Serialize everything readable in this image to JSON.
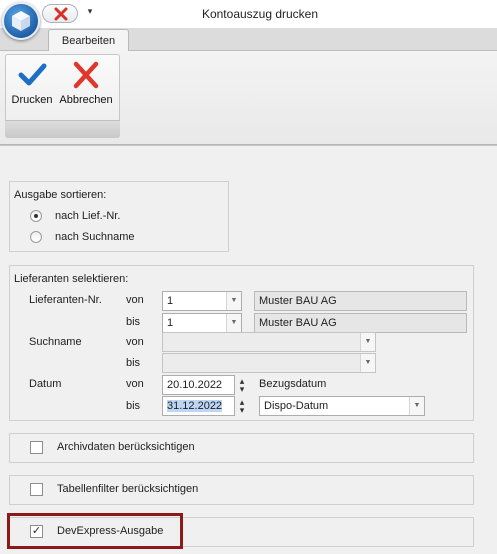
{
  "window": {
    "title": "Kontoauszug drucken",
    "qat_dropdown": "▾"
  },
  "ribbon": {
    "tab": "Bearbeiten",
    "buttons": {
      "print": "Drucken",
      "cancel": "Abbrechen"
    }
  },
  "sort": {
    "title": "Ausgabe sortieren:",
    "options": [
      {
        "label": "nach Lief.-Nr.",
        "selected": true
      },
      {
        "label": "nach Suchname",
        "selected": false
      }
    ]
  },
  "select": {
    "title": "Lieferanten selektieren:",
    "supplier_label": "Lieferanten-Nr.",
    "search_label": "Suchname",
    "date_label": "Datum",
    "from": "von",
    "to": "bis",
    "supplier_from": "1",
    "supplier_from_name": "Muster BAU AG",
    "supplier_to": "1",
    "supplier_to_name": "Muster BAU AG",
    "search_from": "",
    "search_to": "",
    "date_from": "20.10.2022",
    "date_from_type": "Bezugsdatum",
    "date_to": "31.12.2022",
    "date_to_type": "Dispo-Datum"
  },
  "options": {
    "archive": {
      "label": "Archivdaten berücksichtigen",
      "checked": false
    },
    "tablefilter": {
      "label": "Tabellenfilter berücksichtigen",
      "checked": false
    },
    "devexpress": {
      "label": "DevExpress-Ausgabe",
      "checked": true
    }
  },
  "colors": {
    "accent_red": "#8b1a1a",
    "check_blue": "#1e6fc4",
    "cancel_red": "#e0372b"
  }
}
